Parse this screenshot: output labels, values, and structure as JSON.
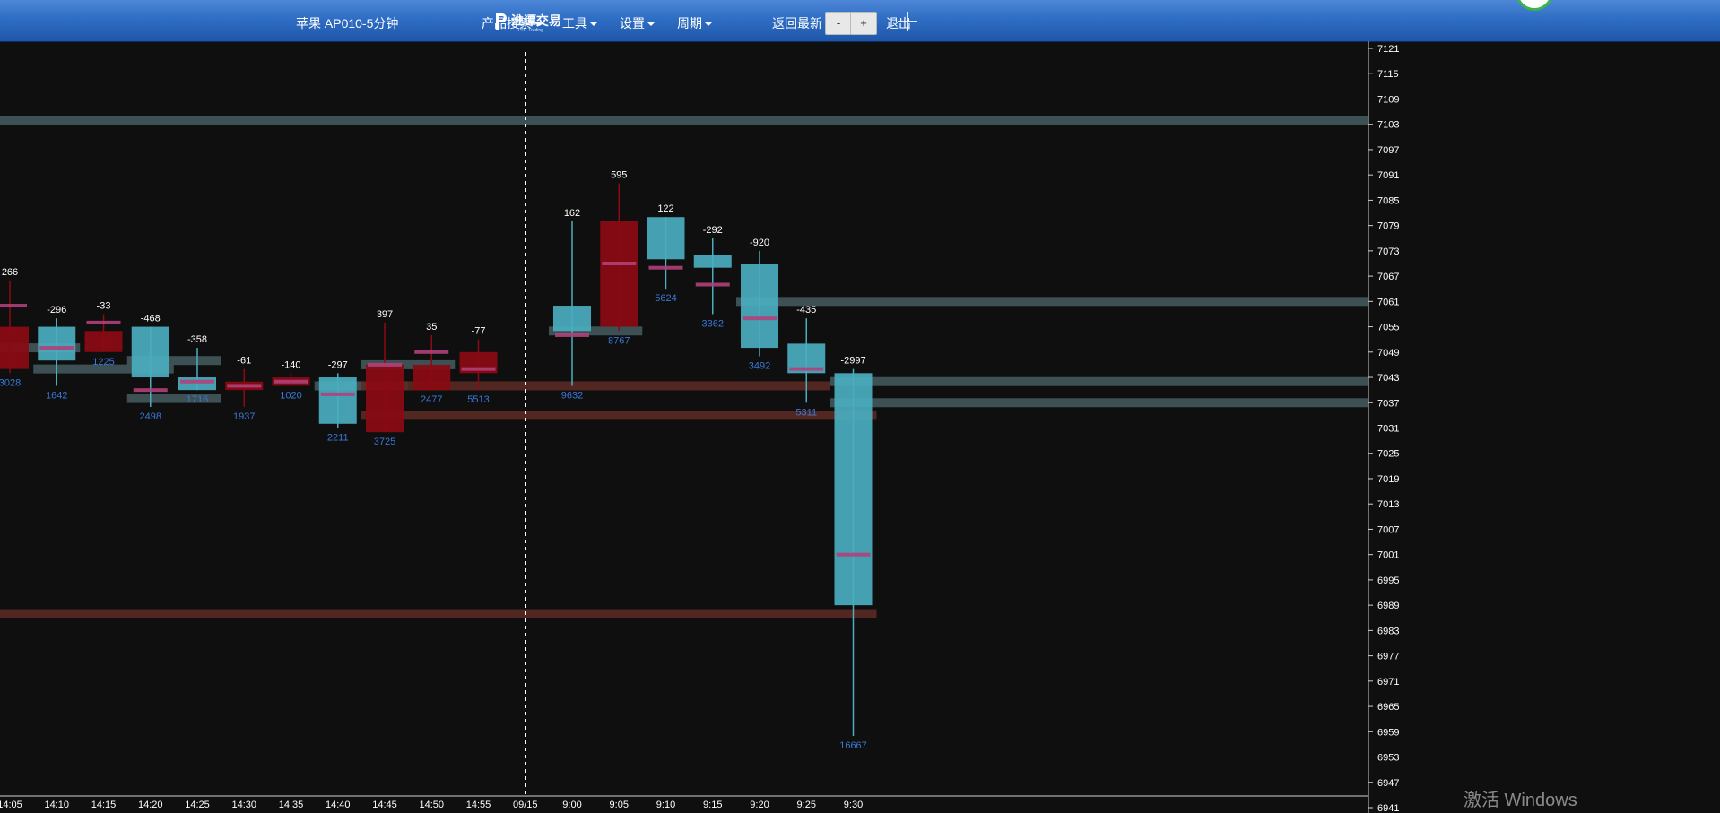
{
  "toolbar": {
    "title": "苹果 AP010-5分钟",
    "logo_text": "淮谭交易",
    "logo_sub": "PRT Trading",
    "menu_product_search": "产品搜索",
    "menu_tools": "工具",
    "menu_settings": "设置",
    "menu_period": "周期",
    "return_latest": "返回最新",
    "zoom_out": "-",
    "zoom_in": "+",
    "exit": "退出"
  },
  "watermark": "激活 Windows",
  "colors": {
    "up": "#8b0a14",
    "down": "#4aaebf",
    "poc": "#b0407a",
    "delta_text": "#ffffff",
    "volume_text": "#3a78d8",
    "zone_gray": "#42585c",
    "zone_red": "#5a2a24",
    "axis_text": "#ffffff",
    "background": "#0f0f0f"
  },
  "chart_data": {
    "type": "candlestick",
    "title": "苹果 AP010-5分钟",
    "y_ticks": [
      7121,
      7115,
      7109,
      7103,
      7097,
      7091,
      7085,
      7079,
      7073,
      7067,
      7061,
      7055,
      7049,
      7043,
      7037,
      7031,
      7025,
      7019,
      7013,
      7007,
      7001,
      6995,
      6989,
      6983,
      6977,
      6971,
      6965,
      6959,
      6953,
      6947,
      6941
    ],
    "ylim": [
      6941,
      7121
    ],
    "x_labels": [
      "14:05",
      "14:10",
      "14:15",
      "14:20",
      "14:25",
      "14:30",
      "14:35",
      "14:40",
      "14:45",
      "14:50",
      "14:55",
      "09/15",
      "9:00",
      "9:05",
      "9:10",
      "9:15",
      "9:20",
      "9:25",
      "9:30"
    ],
    "session_break": "09/15",
    "candles": [
      {
        "time": "14:05",
        "open": 7045,
        "close": 7055,
        "high": 7066,
        "low": 7044,
        "poc": 7060,
        "delta": "266",
        "volume": "3028"
      },
      {
        "time": "14:10",
        "open": 7055,
        "close": 7047,
        "high": 7057,
        "low": 7041,
        "poc": 7050,
        "delta": "-296",
        "volume": "1642"
      },
      {
        "time": "14:15",
        "open": 7049,
        "close": 7054,
        "high": 7058,
        "low": 7049,
        "poc": 7056,
        "delta": "-33",
        "volume": "1225"
      },
      {
        "time": "14:20",
        "open": 7055,
        "close": 7043,
        "high": 7055,
        "low": 7036,
        "poc": 7040,
        "delta": "-468",
        "volume": "2498"
      },
      {
        "time": "14:25",
        "open": 7043,
        "close": 7040,
        "high": 7050,
        "low": 7040,
        "poc": 7042,
        "delta": "-358",
        "volume": "1716"
      },
      {
        "time": "14:30",
        "open": 7040,
        "close": 7042,
        "high": 7045,
        "low": 7036,
        "poc": 7041,
        "delta": "-61",
        "volume": "1937"
      },
      {
        "time": "14:35",
        "open": 7041,
        "close": 7043,
        "high": 7044,
        "low": 7041,
        "poc": 7042,
        "delta": "-140",
        "volume": "1020"
      },
      {
        "time": "14:40",
        "open": 7043,
        "close": 7032,
        "high": 7044,
        "low": 7031,
        "poc": 7039,
        "delta": "-297",
        "volume": "2211"
      },
      {
        "time": "14:45",
        "open": 7030,
        "close": 7046,
        "high": 7056,
        "low": 7030,
        "poc": 7046,
        "delta": "397",
        "volume": "3725"
      },
      {
        "time": "14:50",
        "open": 7040,
        "close": 7046,
        "high": 7053,
        "low": 7040,
        "poc": 7049,
        "delta": "35",
        "volume": "2477"
      },
      {
        "time": "14:55",
        "open": 7044,
        "close": 7049,
        "high": 7052,
        "low": 7040,
        "poc": 7045,
        "delta": "-77",
        "volume": "5513"
      },
      {
        "time": "9:00",
        "open": 7060,
        "close": 7054,
        "high": 7080,
        "low": 7041,
        "poc": 7053,
        "delta": "162",
        "volume": "9632"
      },
      {
        "time": "9:05",
        "open": 7055,
        "close": 7080,
        "high": 7089,
        "low": 7054,
        "poc": 7070,
        "delta": "595",
        "volume": "8767"
      },
      {
        "time": "9:10",
        "open": 7081,
        "close": 7071,
        "high": 7081,
        "low": 7064,
        "poc": 7069,
        "delta": "122",
        "volume": "5624"
      },
      {
        "time": "9:15",
        "open": 7072,
        "close": 7069,
        "high": 7076,
        "low": 7058,
        "poc": 7065,
        "delta": "-292",
        "volume": "3362"
      },
      {
        "time": "9:20",
        "open": 7070,
        "close": 7050,
        "high": 7073,
        "low": 7048,
        "poc": 7057,
        "delta": "-920",
        "volume": "3492"
      },
      {
        "time": "9:25",
        "open": 7051,
        "close": 7044,
        "high": 7057,
        "low": 7037,
        "poc": 7045,
        "delta": "-435",
        "volume": "5311"
      },
      {
        "time": "9:30",
        "open": 7044,
        "close": 6989,
        "high": 7045,
        "low": 6958,
        "poc": 7001,
        "delta": "-2997",
        "volume": "16667"
      }
    ],
    "zones": [
      {
        "price": 7104,
        "from": "start",
        "to": "end",
        "color": "gray"
      },
      {
        "price": 7061,
        "from": "9:20",
        "to": "end",
        "color": "gray"
      },
      {
        "price": 7042,
        "from": "9:30",
        "to": "end",
        "color": "gray"
      },
      {
        "price": 7037,
        "from": "9:30",
        "to": "end",
        "color": "gray"
      },
      {
        "price": 7050,
        "from": "14:05",
        "to": "14:10",
        "color": "gray"
      },
      {
        "price": 7045,
        "from": "14:10",
        "to": "14:20",
        "color": "gray"
      },
      {
        "price": 7047,
        "from": "14:20",
        "to": "14:25",
        "color": "gray"
      },
      {
        "price": 7038,
        "from": "14:20",
        "to": "14:25",
        "color": "gray"
      },
      {
        "price": 7041,
        "from": "14:40",
        "to": "14:45",
        "color": "gray"
      },
      {
        "price": 7046,
        "from": "14:45",
        "to": "14:50",
        "color": "gray"
      },
      {
        "price": 7054,
        "from": "9:00",
        "to": "9:05",
        "color": "gray"
      },
      {
        "price": 7041,
        "from": "14:45",
        "to": "9:25",
        "color": "red"
      },
      {
        "price": 7034,
        "from": "14:45",
        "to": "9:30",
        "color": "red"
      },
      {
        "price": 6987,
        "from": "start",
        "to": "9:30",
        "color": "red"
      }
    ]
  }
}
